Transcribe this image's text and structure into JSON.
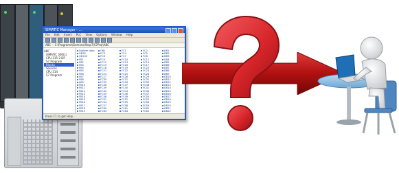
{
  "plc_rack": {
    "label": ""
  },
  "app_window": {
    "title": "SIMATIC Manager - ...",
    "menu_items": [
      "File",
      "Edit",
      "Insert",
      "PLC",
      "View",
      "Options",
      "Window",
      "Help"
    ],
    "address": "ABC -- C:\\Programs\\Siemens\\Step7\\S7Proj\\ABC",
    "tree": [
      {
        "label": "ABC",
        "selected": false
      },
      {
        "label": "SIMATIC 300(1)",
        "selected": false
      },
      {
        "label": "CPU 315-2 DP",
        "selected": false
      },
      {
        "label": "S7 Program",
        "selected": false
      },
      {
        "label": "Blocks",
        "selected": true
      },
      {
        "label": "Sources",
        "selected": false
      },
      {
        "label": "CPU 314",
        "selected": false
      },
      {
        "label": "S7 Program",
        "selected": false
      }
    ],
    "list_items": [
      "System data",
      "OB1",
      "FC1",
      "FC2",
      "DB1",
      "OB35",
      "FC3",
      "FC4",
      "FC5",
      "DB2",
      "OB100",
      "FC6",
      "FC7",
      "FC8",
      "DB3",
      "FB1",
      "FC9",
      "FC10",
      "FC11",
      "DB4",
      "FB2",
      "FC12",
      "FC13",
      "FC14",
      "DB5",
      "FB3",
      "FC15",
      "FC16",
      "FC17",
      "DB6",
      "FB4",
      "FC18",
      "FC19",
      "FC20",
      "DB7",
      "FB5",
      "FC21",
      "FC22",
      "FC23",
      "DB8",
      "FB6",
      "FC24",
      "FC25",
      "FC26",
      "DB9",
      "FB7",
      "FC27",
      "FC28",
      "FC29",
      "DB10",
      "FB8",
      "FC30",
      "FC31",
      "FC32",
      "DB11",
      "FB9",
      "FC33",
      "FC34",
      "FC35",
      "DB12",
      "FB10",
      "FC36",
      "FC37",
      "FC38",
      "DB13",
      "FB11",
      "FC39",
      "FC40",
      "FC41",
      "DB14",
      "FB12",
      "FC42",
      "FC43",
      "FC44",
      "DB15",
      "FB13",
      "FC45",
      "FC46",
      "FC47",
      "DB16",
      "FB14",
      "FC48",
      "FC49",
      "FC50",
      "DB17",
      "FB15",
      "FC51",
      "FC52",
      "FC53",
      "DB18",
      "FB16",
      "FC54",
      "FC55",
      "FC56",
      "DB19",
      "FB17",
      "FC57",
      "FC58",
      "FC59",
      "DB20",
      "FB18",
      "FC60",
      "FC61",
      "FC62",
      "DB21",
      "FB19",
      "FC63",
      "FC64",
      "FC65",
      "DB22"
    ],
    "status": "Press F1 to get Help."
  },
  "colors": {
    "arrow": "#b01010",
    "question_mark": "#d8262b",
    "window_border": "#2857c8",
    "desk_top": "#86b8e0"
  },
  "icons": {
    "arrow": "right-arrow",
    "question": "question-mark",
    "person": "person-at-computer"
  }
}
